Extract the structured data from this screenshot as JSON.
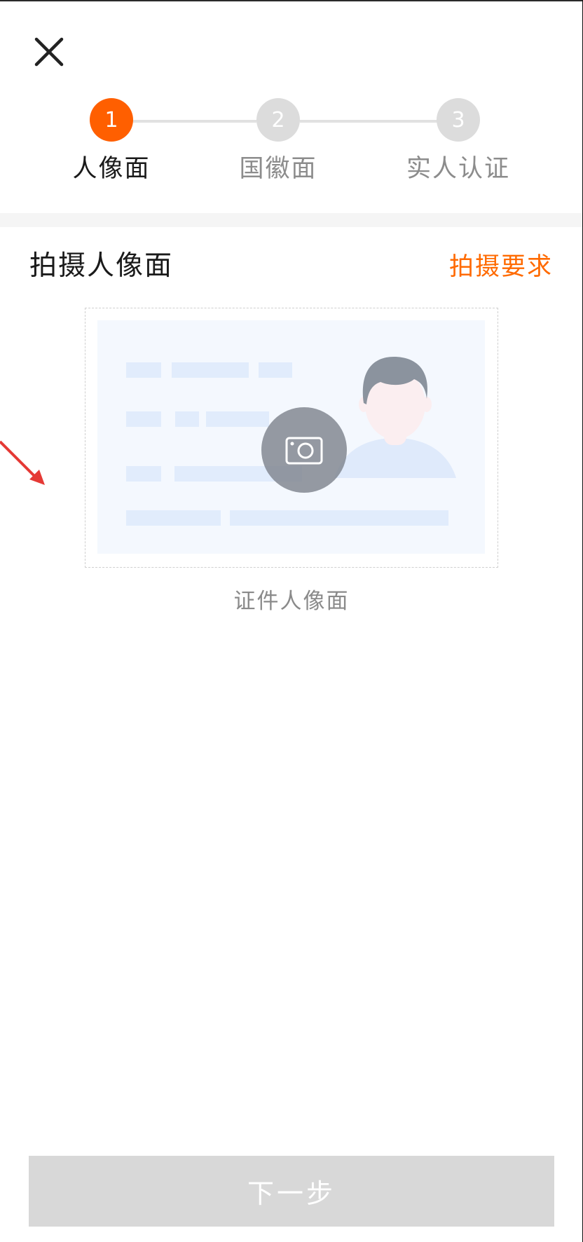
{
  "header": {
    "close_icon": "close-icon"
  },
  "stepper": {
    "steps": [
      {
        "number": "1",
        "label": "人像面",
        "state": "active"
      },
      {
        "number": "2",
        "label": "国徽面",
        "state": "inactive"
      },
      {
        "number": "3",
        "label": "实人认证",
        "state": "inactive"
      }
    ]
  },
  "section": {
    "title": "拍摄人像面",
    "requirements_link": "拍摄要求"
  },
  "capture": {
    "camera_icon": "camera-icon",
    "caption": "证件人像面"
  },
  "footer": {
    "next_label": "下一步"
  },
  "colors": {
    "accent": "#ff6a00",
    "step_active": "#ff5f00",
    "step_inactive": "#dcdcdc",
    "button_disabled": "#d8d8d8"
  }
}
